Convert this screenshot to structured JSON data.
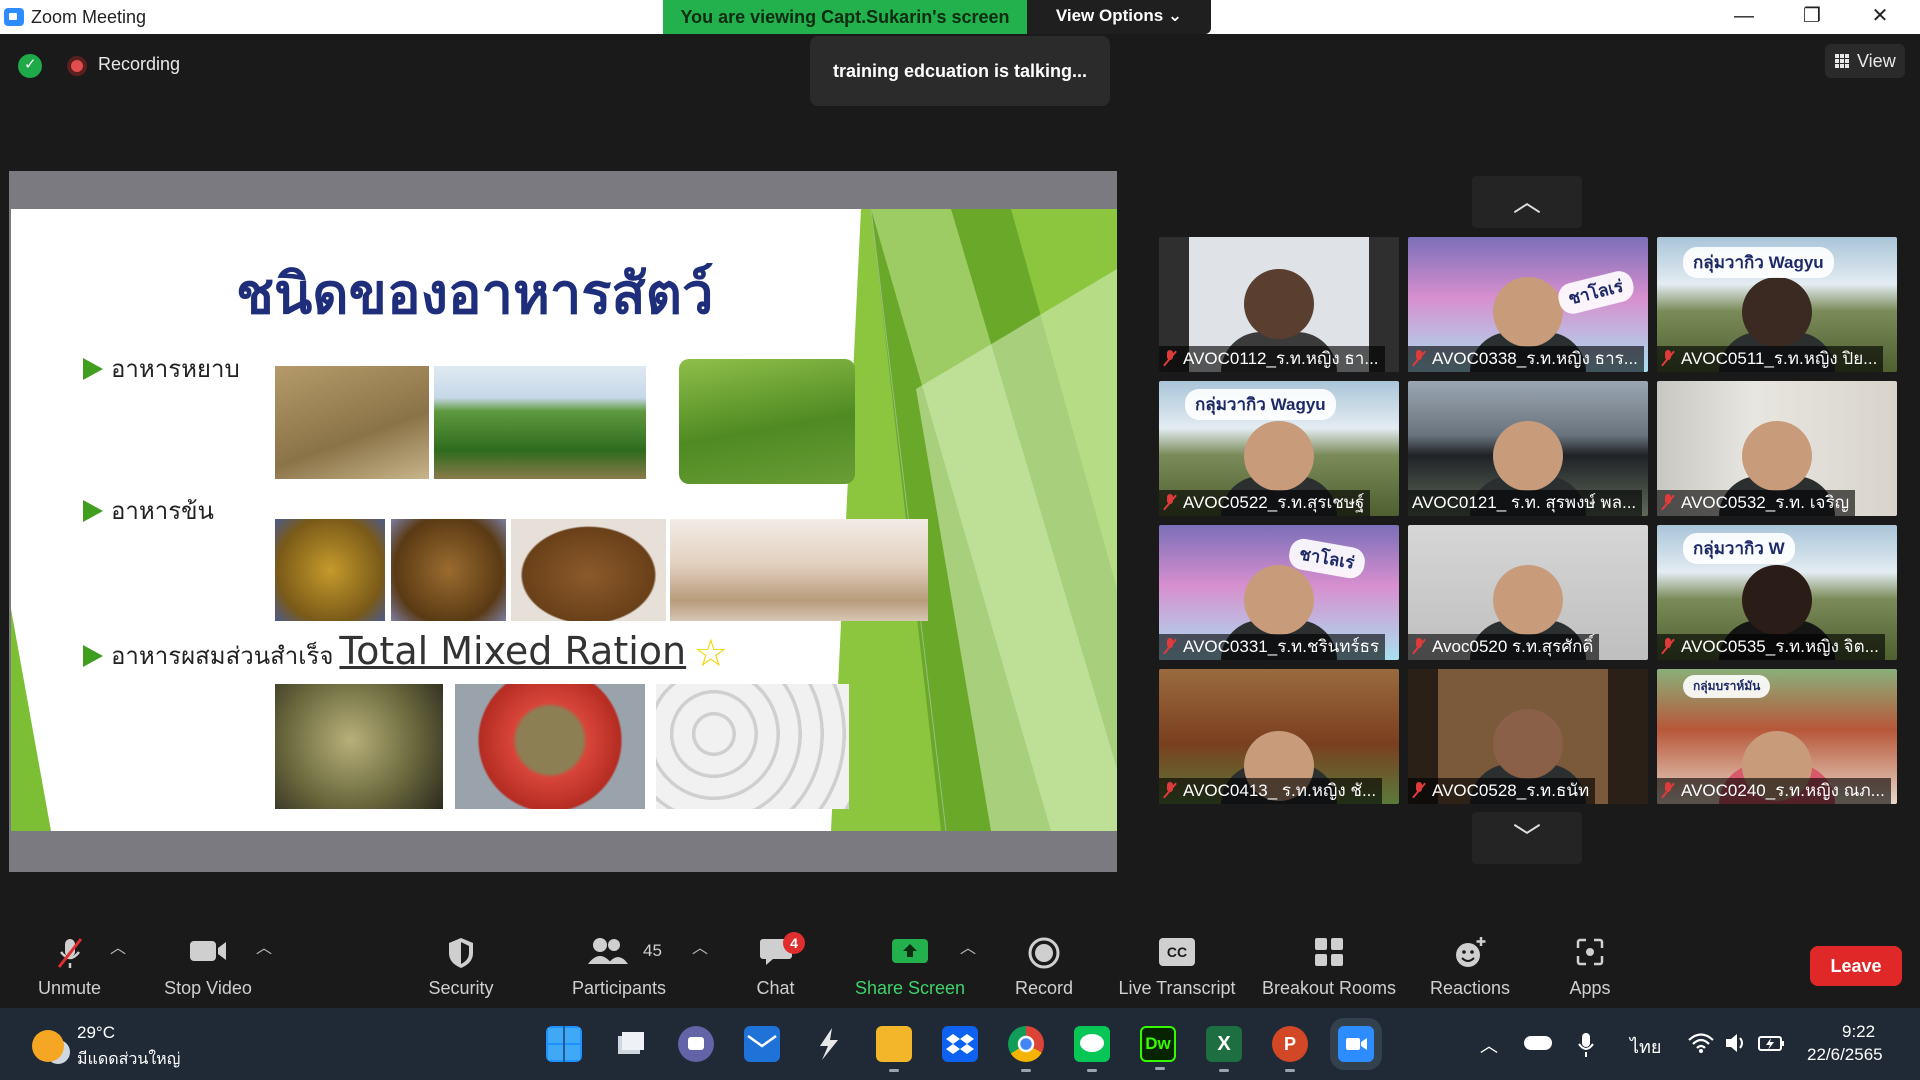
{
  "window": {
    "title": "Zoom Meeting",
    "viewing_banner": "You are viewing Capt.Sukarin's screen",
    "view_options": "View Options ⌄",
    "minimize": "—",
    "maximize": "❐",
    "close": "✕"
  },
  "status": {
    "recording": "Recording",
    "talking": "training edcuation is talking...",
    "view": "View"
  },
  "slide": {
    "title": "ชนิดของอาหารสัตว์",
    "bullets": [
      {
        "text": "อาหารหยาบ"
      },
      {
        "text": "อาหารข้น"
      },
      {
        "text": "อาหารผสมส่วนสำเร็จ",
        "highlight": "Total Mixed Ration",
        "star": "☆"
      }
    ]
  },
  "gallery": {
    "up_arrow": "︿",
    "down_arrow": "﹀",
    "tiles": [
      {
        "name": "AVOC0112_ร.ท.หญิง ธา...",
        "muted": true
      },
      {
        "name": "AVOC0338_ร.ท.หญิง ธาร...",
        "muted": true,
        "banner": "ชาโลเร่"
      },
      {
        "name": "AVOC0511_ร.ท.หญิง ปิย...",
        "muted": true,
        "banner": "กลุ่มวากิว Wagyu"
      },
      {
        "name": "AVOC0522_ร.ท.สุรเชษฐ์",
        "muted": true,
        "banner": "กลุ่มวากิว Wagyu"
      },
      {
        "name": "AVOC0121_ ร.ท. สุรพงษ์  พล...",
        "muted": false
      },
      {
        "name": "AVOC0532_ร.ท. เจริญ",
        "muted": true
      },
      {
        "name": "AVOC0331_ร.ท.ชรินทร์ธร",
        "muted": true,
        "banner": "ชาโลเร่"
      },
      {
        "name": "Avoc0520 ร.ท.สุรศักดิ์",
        "muted": true
      },
      {
        "name": "AVOC0535_ร.ท.หญิง จิต...",
        "muted": true,
        "banner": "กลุ่มวากิว W"
      },
      {
        "name": "AVOC0413_ ร.ท.หญิง ชั...",
        "muted": true
      },
      {
        "name": "AVOC0528_ร.ท.ธนัท",
        "muted": true
      },
      {
        "name": "AVOC0240_ร.ท.หญิง ณภ...",
        "muted": true,
        "banner": "กลุ่มบราห์มัน"
      }
    ]
  },
  "toolbar": {
    "unmute": "Unmute",
    "stop_video": "Stop Video",
    "security": "Security",
    "participants": "Participants",
    "participants_count": "45",
    "chat": "Chat",
    "chat_badge": "4",
    "share_screen": "Share Screen",
    "record": "Record",
    "live_transcript": "Live Transcript",
    "cc": "CC",
    "breakout_rooms": "Breakout Rooms",
    "reactions": "Reactions",
    "apps": "Apps",
    "leave": "Leave"
  },
  "taskbar": {
    "temp": "29°C",
    "weather": "มีแดดส่วนใหญ่",
    "lang": "ไทย",
    "time": "9:22",
    "date": "22/6/2565",
    "apps": [
      "start-icon",
      "task-view-icon",
      "teams-chat-icon",
      "mail-icon",
      "sketch-icon",
      "file-explorer-icon",
      "dropbox-icon",
      "chrome-icon",
      "line-icon",
      "dreamweaver-icon",
      "excel-icon",
      "powerpoint-icon",
      "zoom-icon"
    ]
  },
  "colors": {
    "accent_green": "#23b14d",
    "leave_red": "#e02828",
    "zoom_blue": "#2d8cff",
    "slide_title_blue": "#1e2e7a"
  }
}
